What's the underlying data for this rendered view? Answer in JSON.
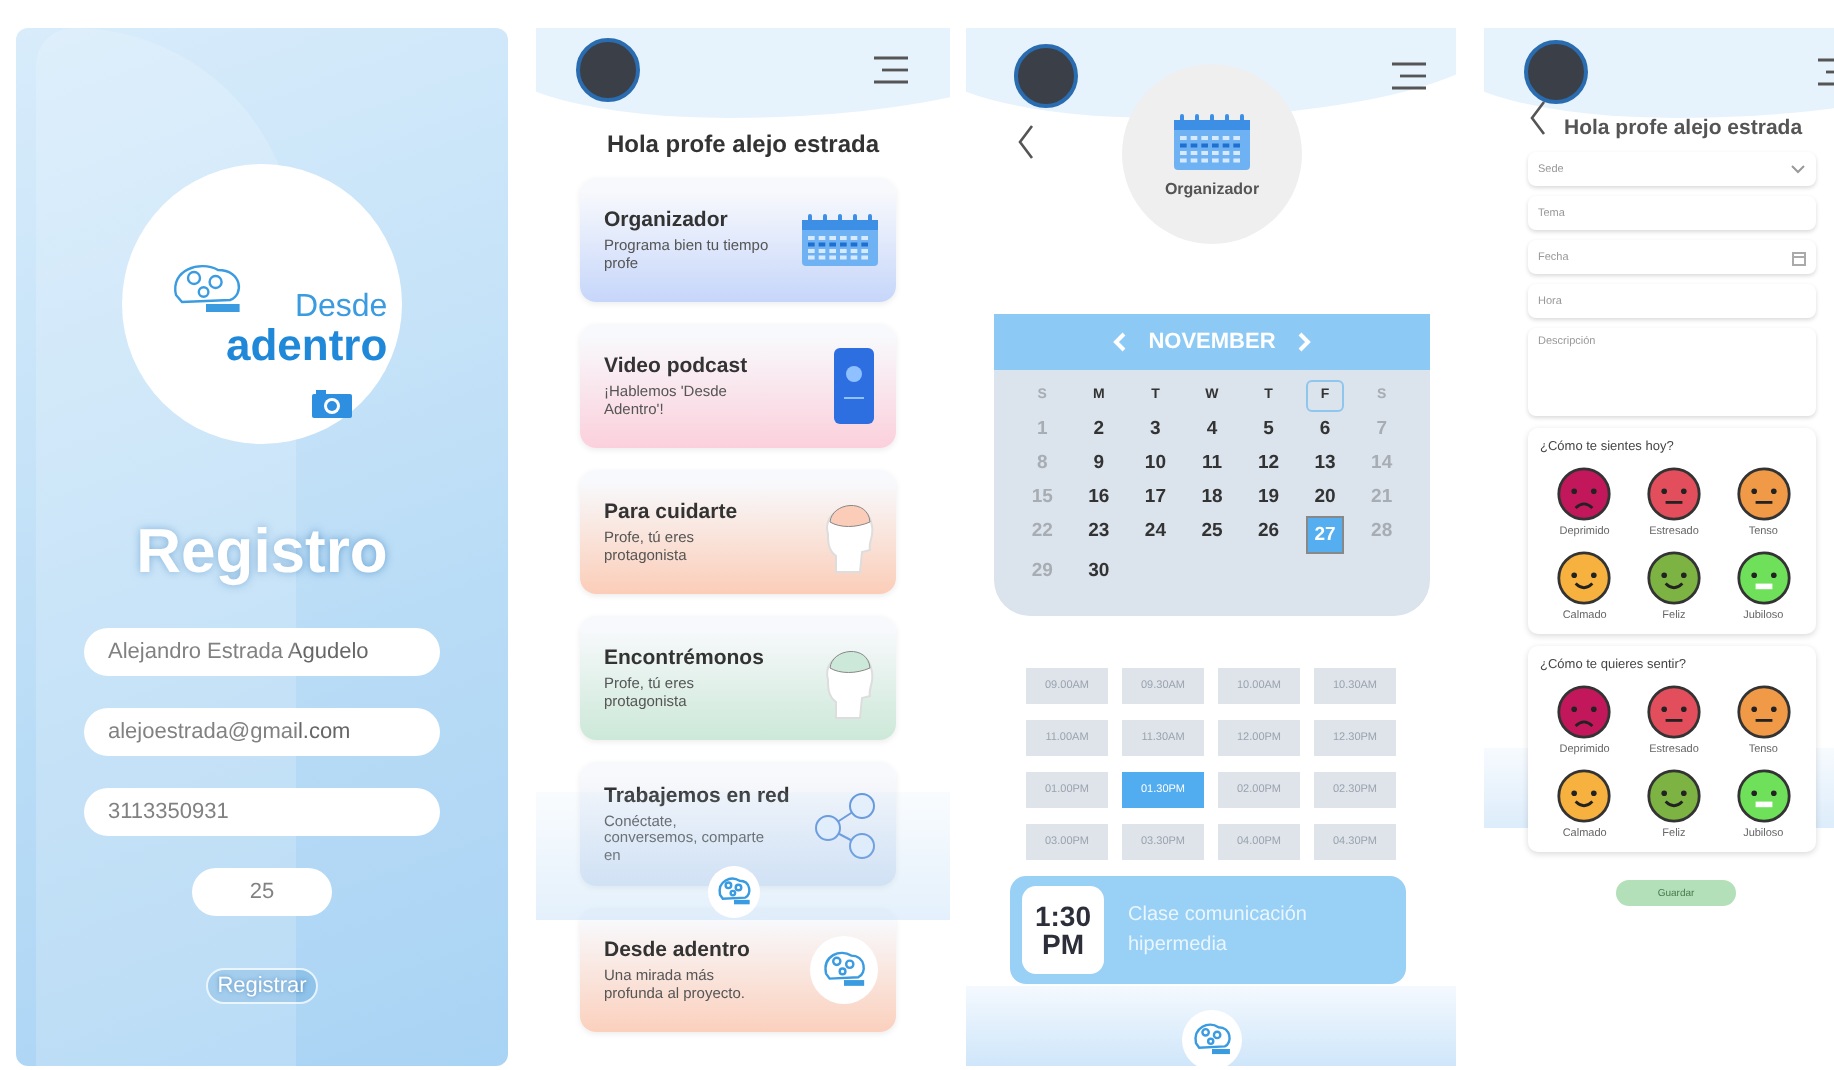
{
  "screens": [
    {
      "kind": "registro",
      "logo": {
        "line_1": "Desde",
        "line_2": "adentro"
      },
      "title": "Registro",
      "fields": [
        {
          "value": "Alejandro Estrada Agudelo",
          "kind": "wide"
        },
        {
          "value": "alejoestrada@gmail.com",
          "kind": "wide"
        },
        {
          "value": "3113350931",
          "kind": "wide"
        },
        {
          "value": "25",
          "kind": "short"
        }
      ],
      "button": "Registrar"
    },
    {
      "kind": "menu",
      "greeting": "Hola profe alejo estrada",
      "cards": [
        {
          "title": "Organizador",
          "subtitle": "Programa bien tu tiempo profe",
          "color": "#c6d6fa",
          "kind": "calendar"
        },
        {
          "title": "Video podcast",
          "subtitle": "¡Hablemos 'Desde Adentro'!",
          "color": "#fbd0dc",
          "kind": "phone"
        },
        {
          "title": "Para cuidarte",
          "subtitle": "Profe, tú eres protagonista",
          "color": "#fbcdb8",
          "kind": "head"
        },
        {
          "title": "Encontrémonos",
          "subtitle": "Profe, tú eres protagonista",
          "color": "#cce8d8",
          "kind": "head"
        },
        {
          "title": "Trabajemos en red",
          "subtitle": "Conéctate, conversemos, comparte en",
          "color": "#dbe5f4",
          "kind": "network"
        },
        {
          "title": "Desde adentro",
          "subtitle": "Una mirada más profunda al proyecto.",
          "color": "#fbd0bd",
          "kind": "logo"
        }
      ]
    },
    {
      "kind": "organizador",
      "badge": "Organizador",
      "calendar": {
        "month": "NOVEMBER",
        "weekdays": [
          {
            "label": "S",
            "muted": true,
            "selected": false
          },
          {
            "label": "M",
            "muted": false,
            "selected": false
          },
          {
            "label": "T",
            "muted": false,
            "selected": false
          },
          {
            "label": "W",
            "muted": false,
            "selected": false
          },
          {
            "label": "T",
            "muted": false,
            "selected": false
          },
          {
            "label": "F",
            "muted": false,
            "selected": true
          },
          {
            "label": "S",
            "muted": true,
            "selected": false
          }
        ],
        "days": [
          {
            "label": "1",
            "muted": true,
            "selected": false
          },
          {
            "label": "2",
            "muted": false,
            "selected": false
          },
          {
            "label": "3",
            "muted": false,
            "selected": false
          },
          {
            "label": "4",
            "muted": false,
            "selected": false
          },
          {
            "label": "5",
            "muted": false,
            "selected": false
          },
          {
            "label": "6",
            "muted": false,
            "selected": false
          },
          {
            "label": "7",
            "muted": true,
            "selected": false
          },
          {
            "label": "8",
            "muted": true,
            "selected": false
          },
          {
            "label": "9",
            "muted": false,
            "selected": false
          },
          {
            "label": "10",
            "muted": false,
            "selected": false
          },
          {
            "label": "11",
            "muted": false,
            "selected": false
          },
          {
            "label": "12",
            "muted": false,
            "selected": false
          },
          {
            "label": "13",
            "muted": false,
            "selected": false
          },
          {
            "label": "14",
            "muted": true,
            "selected": false
          },
          {
            "label": "15",
            "muted": true,
            "selected": false
          },
          {
            "label": "16",
            "muted": false,
            "selected": false
          },
          {
            "label": "17",
            "muted": false,
            "selected": false
          },
          {
            "label": "18",
            "muted": false,
            "selected": false
          },
          {
            "label": "19",
            "muted": false,
            "selected": false
          },
          {
            "label": "20",
            "muted": false,
            "selected": false
          },
          {
            "label": "21",
            "muted": true,
            "selected": false
          },
          {
            "label": "22",
            "muted": true,
            "selected": false
          },
          {
            "label": "23",
            "muted": false,
            "selected": false
          },
          {
            "label": "24",
            "muted": false,
            "selected": false
          },
          {
            "label": "25",
            "muted": false,
            "selected": false
          },
          {
            "label": "26",
            "muted": false,
            "selected": false
          },
          {
            "label": "27",
            "muted": false,
            "selected": true
          },
          {
            "label": "28",
            "muted": true,
            "selected": false
          },
          {
            "label": "29",
            "muted": true,
            "selected": false
          },
          {
            "label": "30",
            "muted": false,
            "selected": false
          }
        ]
      },
      "slots": [
        {
          "label": "09.00AM",
          "selected": false
        },
        {
          "label": "09.30AM",
          "selected": false
        },
        {
          "label": "10.00AM",
          "selected": false
        },
        {
          "label": "10.30AM",
          "selected": false
        },
        {
          "label": "11.00AM",
          "selected": false
        },
        {
          "label": "11.30AM",
          "selected": false
        },
        {
          "label": "12.00PM",
          "selected": false
        },
        {
          "label": "12.30PM",
          "selected": false
        },
        {
          "label": "01.00PM",
          "selected": false
        },
        {
          "label": "01.30PM",
          "selected": true
        },
        {
          "label": "02.00PM",
          "selected": false
        },
        {
          "label": "02.30PM",
          "selected": false
        },
        {
          "label": "03.00PM",
          "selected": false
        },
        {
          "label": "03.30PM",
          "selected": false
        },
        {
          "label": "04.00PM",
          "selected": false
        },
        {
          "label": "04.30PM",
          "selected": false
        }
      ],
      "event": {
        "time": "1:30",
        "period": "PM",
        "title": "Clase comunicación hipermedia"
      }
    },
    {
      "kind": "form",
      "greeting": "Hola profe alejo estrada",
      "fields": [
        {
          "placeholder": "Sede",
          "kind": "select"
        },
        {
          "placeholder": "Tema",
          "kind": "text"
        },
        {
          "placeholder": "Fecha",
          "kind": "date"
        },
        {
          "placeholder": "Hora",
          "kind": "text"
        },
        {
          "placeholder": "Descripción",
          "kind": "area"
        }
      ],
      "mood_groups": [
        {
          "question": "¿Cómo te sientes hoy?",
          "moods": [
            {
              "label": "Deprimido",
              "color": "#c2185b",
              "kind": "frown"
            },
            {
              "label": "Estresado",
              "color": "#e24e5c",
              "kind": "flat"
            },
            {
              "label": "Tenso",
              "color": "#f09a48",
              "kind": "flat"
            },
            {
              "label": "Calmado",
              "color": "#f7b13e",
              "kind": "smile"
            },
            {
              "label": "Feliz",
              "color": "#7cb342",
              "kind": "smile"
            },
            {
              "label": "Jubiloso",
              "color": "#6ee05a",
              "kind": "grin"
            }
          ]
        },
        {
          "question": "¿Cómo te quieres sentir?",
          "moods": [
            {
              "label": "Deprimido",
              "color": "#c2185b",
              "kind": "frown"
            },
            {
              "label": "Estresado",
              "color": "#e24e5c",
              "kind": "flat"
            },
            {
              "label": "Tenso",
              "color": "#f09a48",
              "kind": "flat"
            },
            {
              "label": "Calmado",
              "color": "#f7b13e",
              "kind": "smile"
            },
            {
              "label": "Feliz",
              "color": "#7cb342",
              "kind": "smile"
            },
            {
              "label": "Jubiloso",
              "color": "#6ee05a",
              "kind": "grin"
            }
          ]
        }
      ],
      "button": "Guardar"
    }
  ]
}
